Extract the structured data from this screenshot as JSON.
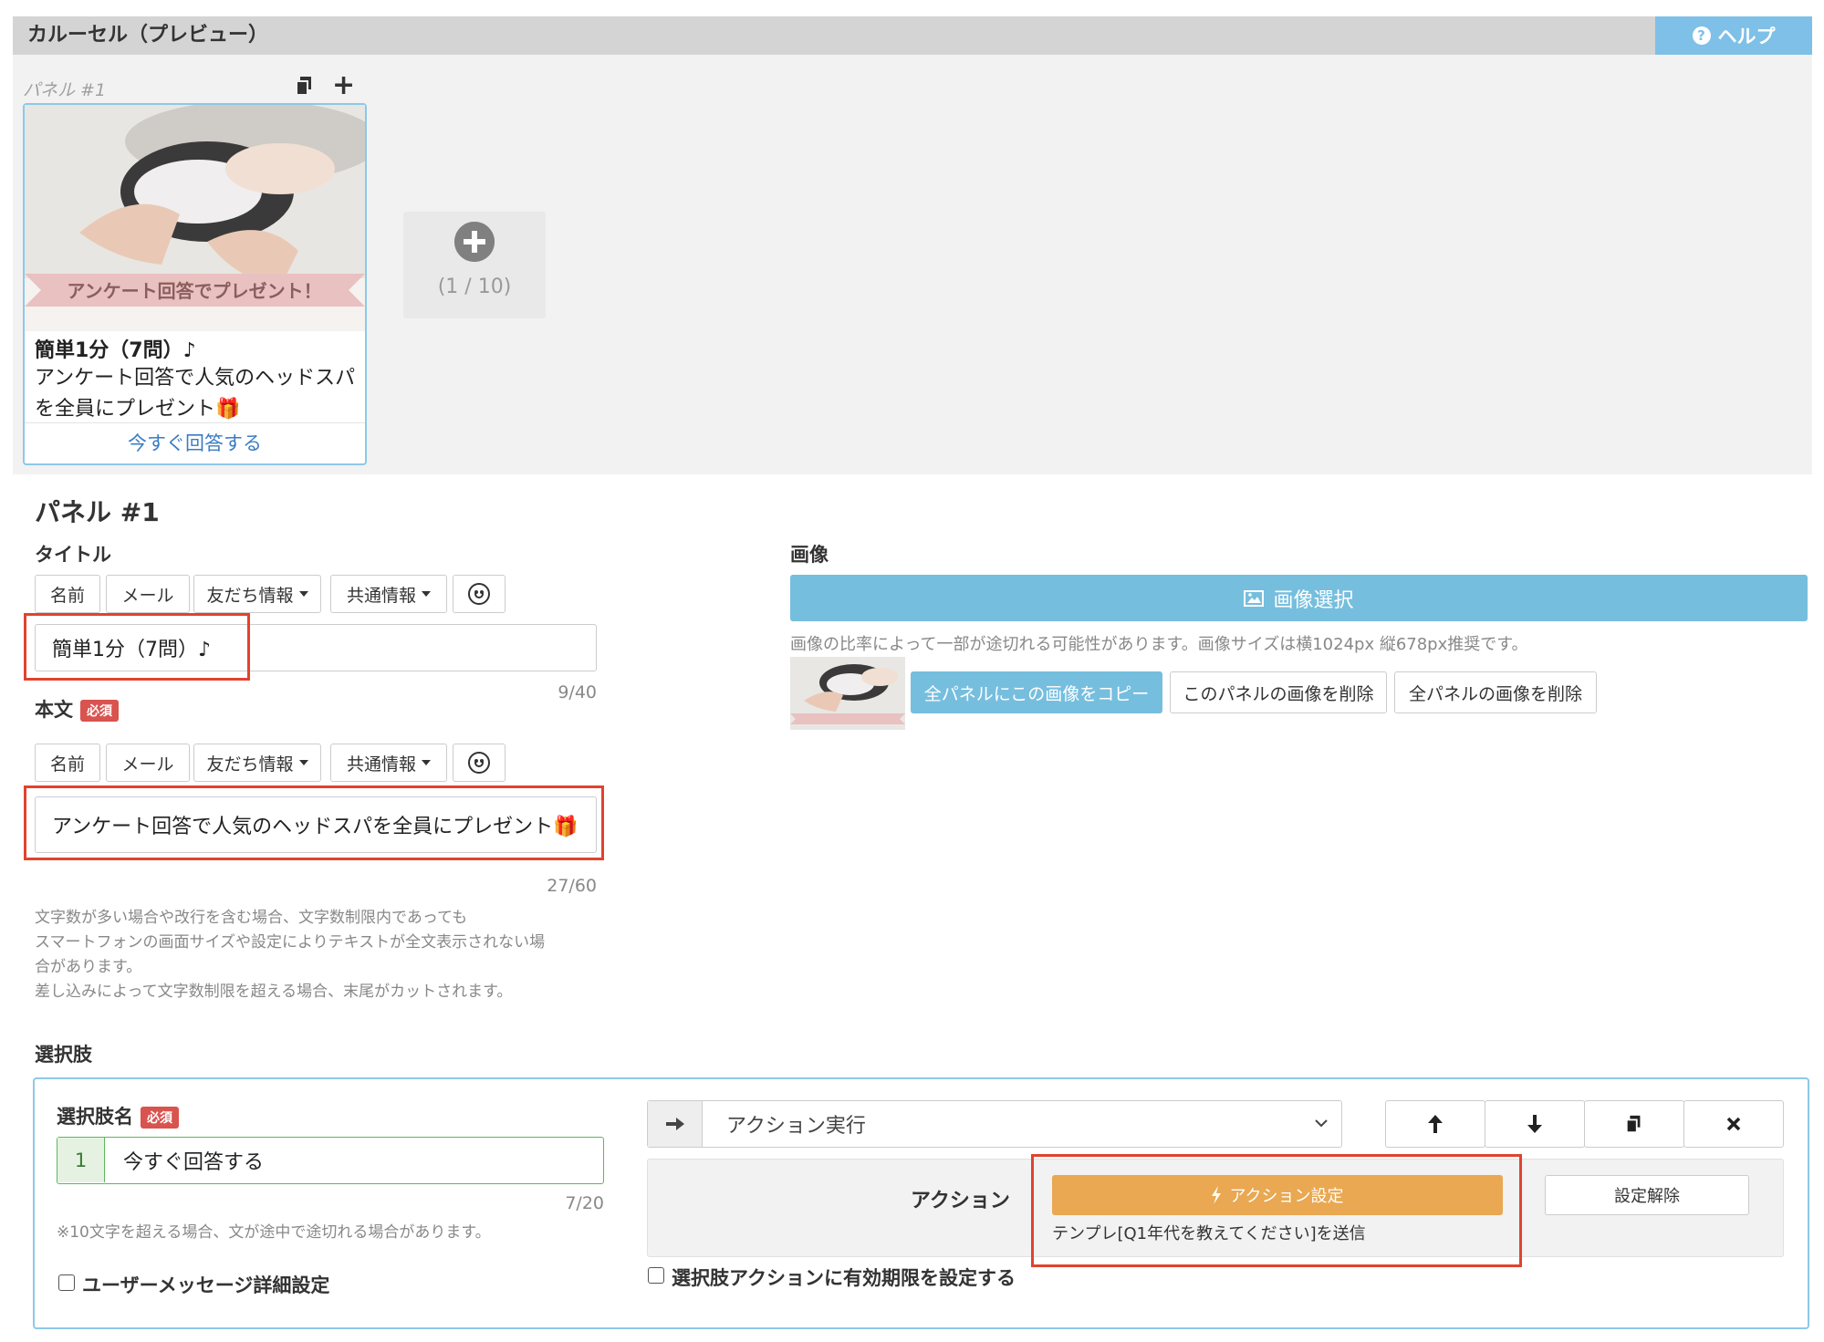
{
  "header": {
    "title": "カルーセル（プレビュー）",
    "help_label": "ヘルプ",
    "help_icon": "question-circle-icon"
  },
  "preview": {
    "panel_label": "パネル #1",
    "card": {
      "image_banner": "アンケート回答でプレゼント！",
      "title": "簡単1分（7問）♪",
      "body": "アンケート回答で人気のヘッドスパを全員にプレゼント🎁",
      "action_label": "今すぐ回答する"
    },
    "add_panel": {
      "count": "(1 / 10)"
    }
  },
  "panel": {
    "heading": "パネル #1",
    "title_section": {
      "label": "タイトル",
      "toolbar": [
        "名前",
        "メール",
        "友だち情報",
        "共通情報"
      ],
      "value": "簡単1分（7問）♪",
      "counter": "9/40"
    },
    "body_section": {
      "label": "本文",
      "required": "必須",
      "toolbar": [
        "名前",
        "メール",
        "友だち情報",
        "共通情報"
      ],
      "value": "アンケート回答で人気のヘッドスパを全員にプレゼント🎁",
      "counter": "27/60",
      "notes": [
        "文字数が多い場合や改行を含む場合、文字数制限内であっても",
        "スマートフォンの画面サイズや設定によりテキストが全文表示されない場",
        "合があります。",
        "差し込みによって文字数制限を超える場合、末尾がカットされます。"
      ]
    },
    "image_section": {
      "label": "画像",
      "select_button": "画像選択",
      "hint": "画像の比率によって一部が途切れる可能性があります。画像サイズは横1024px 縦678px推奨です。",
      "copy_all": "全パネルにこの画像をコピー",
      "delete_this": "このパネルの画像を削除",
      "delete_all": "全パネルの画像を削除"
    },
    "choices": {
      "label": "選択肢",
      "name_label": "選択肢名",
      "required": "必須",
      "index": "1",
      "value": "今すぐ回答する",
      "counter": "7/20",
      "note": "※10文字を超える場合、文が途中で途切れる場合があります。",
      "user_msg_detail": "ユーザーメッセージ詳細設定",
      "action_type": "アクション実行",
      "action_heading": "アクション",
      "action_button": "アクション設定",
      "clear_button": "設定解除",
      "action_summary": "テンプレ[Q1年代を教えてください]を送信",
      "expiry_checkbox": "選択肢アクションに有効期限を設定する"
    }
  },
  "colors": {
    "accent_blue": "#76bede",
    "help_blue": "#7ec0e8",
    "required_red": "#d9534f",
    "highlight_red": "#e0432f",
    "action_orange": "#e9a851",
    "link_blue": "#3a7cc5"
  }
}
